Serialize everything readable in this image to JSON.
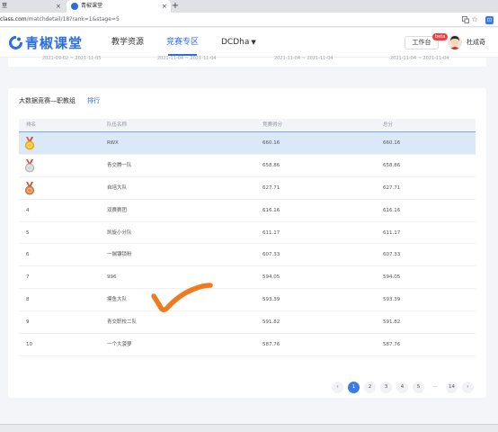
{
  "browser": {
    "tabs": [
      {
        "label": "莖"
      },
      {
        "label": "青椒课堂"
      }
    ],
    "tab_close_glyph": "×",
    "new_tab_glyph": "+",
    "url_host": "class.com",
    "url_path": "/matchdetail/18?rank=1&stage=5",
    "icons": [
      "translate-icon",
      "star-icon",
      "extension-icon"
    ]
  },
  "site": {
    "logo_text": "青椒课堂",
    "nav": [
      {
        "label": "教学资源"
      },
      {
        "label": "竞赛专区",
        "active": true
      },
      {
        "label": "DCDha"
      }
    ],
    "nav_caret": "▼",
    "workbench_label": "工作台",
    "beta_badge": "beta",
    "username": "杜成奇",
    "accent_color": "#2d6de0"
  },
  "prev_card": {
    "dates": [
      "2021-09-02 ~ 2021-11-05",
      "2021-11-04 ~ 2021-11-04",
      "2021-11-04 ~ 2021-11-04",
      "2021-11-04 ~ 2021-11-04"
    ]
  },
  "leaderboard": {
    "title": "大数据竞赛—职教组",
    "link": "排行",
    "headers": [
      "排名",
      "队伍名称",
      "竞赛得分",
      "总分"
    ],
    "rows": [
      {
        "rank": "1",
        "medal": "gold",
        "team": "RWX",
        "score": "660.16",
        "total": "660.16"
      },
      {
        "rank": "2",
        "medal": "silver",
        "team": "青交腾一队",
        "score": "658.86",
        "total": "658.86"
      },
      {
        "rank": "3",
        "medal": "bronze",
        "team": "自培大队",
        "score": "627.71",
        "total": "627.71"
      },
      {
        "rank": "4",
        "team": "双赛赛团",
        "score": "616.16",
        "total": "616.16"
      },
      {
        "rank": "5",
        "team": "凯旋小分队",
        "score": "611.17",
        "total": "611.17"
      },
      {
        "rank": "6",
        "team": "一揣镰锁粉",
        "score": "607.33",
        "total": "607.33"
      },
      {
        "rank": "7",
        "team": "996",
        "score": "594.05",
        "total": "594.05"
      },
      {
        "rank": "8",
        "team": "摸鱼大队",
        "score": "593.39",
        "total": "593.39"
      },
      {
        "rank": "9",
        "team": "青交职校二队",
        "score": "591.82",
        "total": "591.82"
      },
      {
        "rank": "10",
        "team": "一个大菠萝",
        "score": "587.76",
        "total": "587.76"
      }
    ],
    "highlight_row_color": "#dbe8f8"
  },
  "pagination": {
    "prev": "‹",
    "pages": [
      "1",
      "2",
      "3",
      "4",
      "5"
    ],
    "ellipsis": "···",
    "last": "14",
    "next": "›",
    "current": "1"
  },
  "annotation": {
    "icon": "hand-drawn-checkmark",
    "color": "#f07a1e"
  }
}
